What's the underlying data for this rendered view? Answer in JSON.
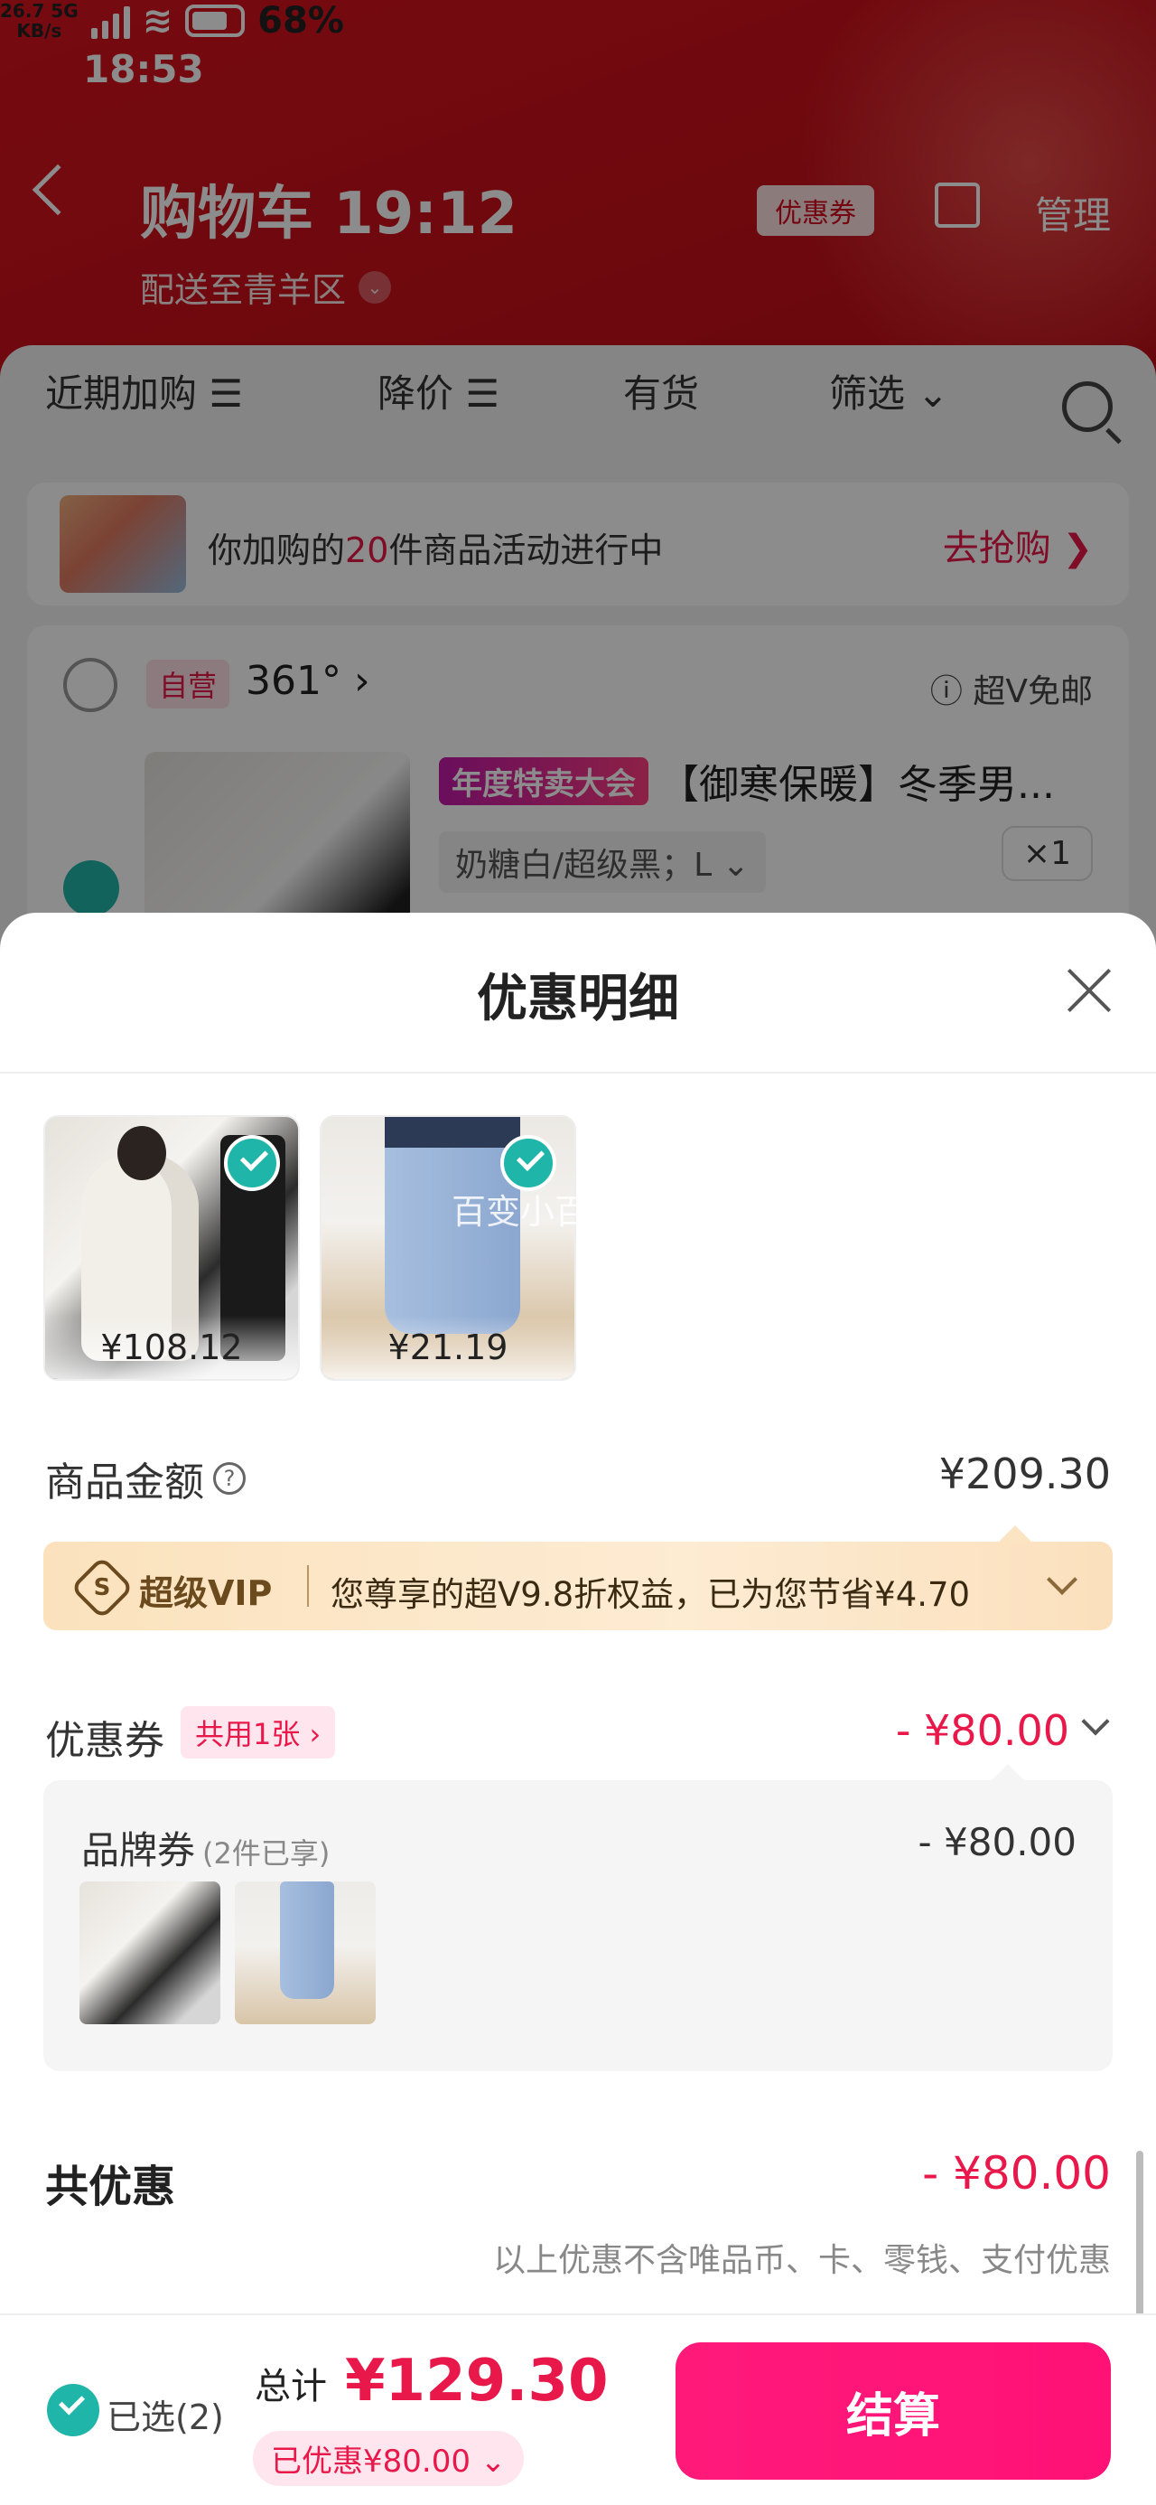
{
  "status_bar": {
    "time": "18:53",
    "net_speed_top": "26.7 5G",
    "net_speed_bottom": "KB/s",
    "battery": "68%"
  },
  "header": {
    "title": "购物车 19:12",
    "delivery": "配送至青羊区",
    "coupon_button": "优惠券",
    "manage": "管理"
  },
  "filters": [
    {
      "label": "近期加购 ☰"
    },
    {
      "label": "降价 ☰"
    },
    {
      "label": "有货"
    },
    {
      "label": "筛选 ⌄"
    }
  ],
  "promo": {
    "prefix": "你加购的",
    "count": "20",
    "suffix": "件商品活动进行中",
    "action": "去抢购 ❯"
  },
  "store": {
    "self_tag": "自营",
    "name": "361° ›",
    "shipping": "ⓘ 超V免邮"
  },
  "product": {
    "tag": "年度特卖大会",
    "title": "【御寒保暖】冬季男...",
    "sku": "奶糖白/超级黑；L ⌄",
    "qty": "×1"
  },
  "sheet": {
    "title": "优惠明细",
    "items": [
      {
        "price": "¥108.12"
      },
      {
        "price": "¥21.19"
      }
    ],
    "watermark": "百变小百货",
    "goods_label": "商品金额",
    "goods_amount": "¥209.30",
    "vip": {
      "badge_symbol": "S",
      "name": "超级VIP",
      "text": "您尊享的超V9.8折权益，已为您节省¥4.70"
    },
    "coupon": {
      "label": "优惠券",
      "shared": "共用1张 ›",
      "amount": "- ¥80.00"
    },
    "brand": {
      "label": "品牌券",
      "count": "(2件已享)",
      "amount": "- ¥80.00"
    },
    "total": {
      "label": "共优惠",
      "amount": "- ¥80.00"
    },
    "disclaimer": "以上优惠不含唯品币、卡、零钱、支付优惠"
  },
  "bottom_bar": {
    "selected": "已选(2)",
    "total_label": "总计",
    "total_price": "¥129.30",
    "discount": "已优惠¥80.00 ⌄",
    "checkout": "结算"
  },
  "colors": {
    "accent": "#e8194a",
    "checkout": "#ff1a7a",
    "check": "#1fb5a8",
    "header_red": "#c3101a",
    "vip_bg": "#fbe2bd"
  }
}
